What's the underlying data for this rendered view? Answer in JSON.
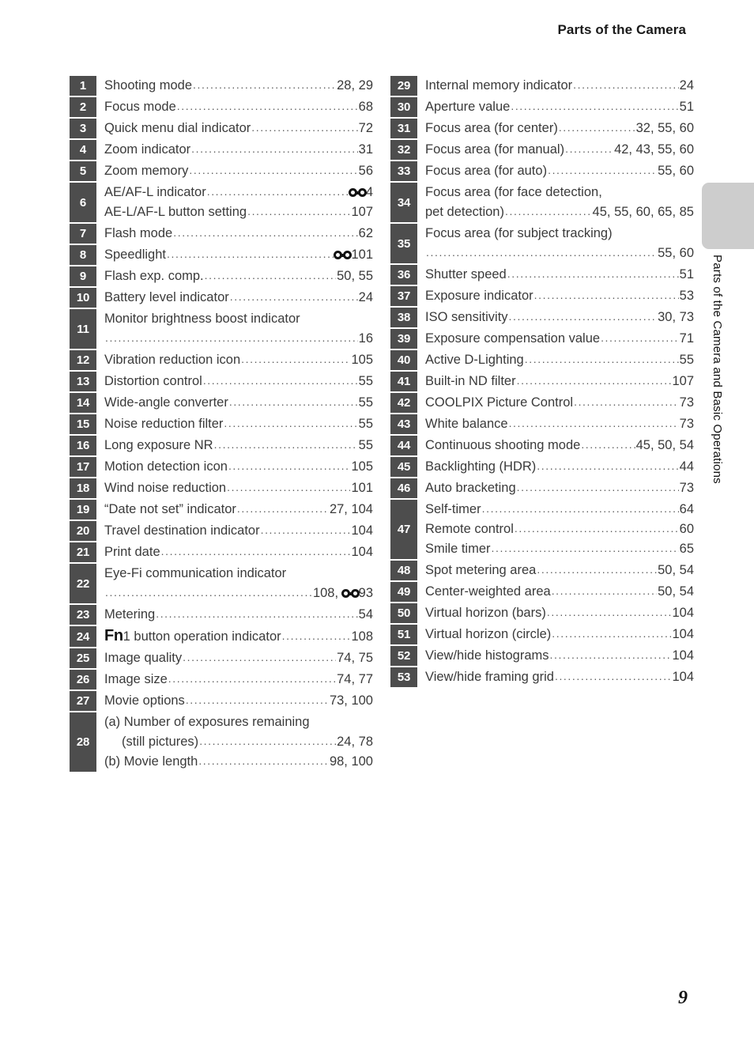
{
  "header": {
    "title": "Parts of the Camera"
  },
  "side_tab": {
    "label": "Parts of the Camera and Basic Operations"
  },
  "folio": {
    "page_number": "9"
  },
  "icons": {
    "reference_mark": "reference-section-icon",
    "fn_mark": "Fn"
  },
  "colors": {
    "badge_bg": "#4d4d4d",
    "badge_text": "#ffffff",
    "body_text": "#3a3a3a",
    "tab_gray": "#cdcdcd"
  },
  "left_column": [
    {
      "num": "1",
      "lines": [
        {
          "label": "Shooting mode",
          "pages": "28, 29"
        }
      ]
    },
    {
      "num": "2",
      "lines": [
        {
          "label": "Focus mode",
          "pages": "68"
        }
      ]
    },
    {
      "num": "3",
      "lines": [
        {
          "label": "Quick menu dial indicator",
          "pages": "72"
        }
      ]
    },
    {
      "num": "4",
      "lines": [
        {
          "label": "Zoom indicator",
          "pages": "31"
        }
      ]
    },
    {
      "num": "5",
      "lines": [
        {
          "label": "Zoom memory",
          "pages": "56"
        }
      ]
    },
    {
      "num": "6",
      "lines": [
        {
          "label": "AE/AF-L indicator",
          "pages": "4",
          "ref": true
        },
        {
          "label": "AE-L/AF-L button setting",
          "pages": "107"
        }
      ]
    },
    {
      "num": "7",
      "lines": [
        {
          "label": "Flash mode",
          "pages": "62"
        }
      ]
    },
    {
      "num": "8",
      "lines": [
        {
          "label": "Speedlight",
          "pages": "101",
          "ref": true
        }
      ]
    },
    {
      "num": "9",
      "lines": [
        {
          "label": "Flash exp. comp.",
          "pages": "50, 55"
        }
      ]
    },
    {
      "num": "10",
      "lines": [
        {
          "label": "Battery level indicator",
          "pages": "24"
        }
      ]
    },
    {
      "num": "11",
      "lines": [
        {
          "label": "Monitor brightness boost indicator",
          "pages": ""
        },
        {
          "label": "",
          "pages": "16",
          "continuation": true
        }
      ]
    },
    {
      "num": "12",
      "lines": [
        {
          "label": "Vibration reduction icon",
          "pages": "105"
        }
      ]
    },
    {
      "num": "13",
      "lines": [
        {
          "label": "Distortion control",
          "pages": "55"
        }
      ]
    },
    {
      "num": "14",
      "lines": [
        {
          "label": "Wide-angle converter",
          "pages": "55"
        }
      ]
    },
    {
      "num": "15",
      "lines": [
        {
          "label": "Noise reduction filter",
          "pages": "55"
        }
      ]
    },
    {
      "num": "16",
      "lines": [
        {
          "label": "Long exposure NR",
          "pages": "55"
        }
      ]
    },
    {
      "num": "17",
      "lines": [
        {
          "label": "Motion detection icon",
          "pages": "105"
        }
      ]
    },
    {
      "num": "18",
      "lines": [
        {
          "label": "Wind noise reduction",
          "pages": "101"
        }
      ]
    },
    {
      "num": "19",
      "lines": [
        {
          "label": "“Date not set” indicator",
          "pages": "27, 104"
        }
      ]
    },
    {
      "num": "20",
      "lines": [
        {
          "label": "Travel destination indicator",
          "pages": "104"
        }
      ]
    },
    {
      "num": "21",
      "lines": [
        {
          "label": "Print date",
          "pages": "104"
        }
      ]
    },
    {
      "num": "22",
      "lines": [
        {
          "label": "Eye-Fi communication indicator",
          "pages": ""
        },
        {
          "label": "",
          "pages": "108, 93",
          "ref_inline": true,
          "continuation": true
        }
      ]
    },
    {
      "num": "23",
      "lines": [
        {
          "label": "Metering",
          "pages": "54"
        }
      ]
    },
    {
      "num": "24",
      "lines": [
        {
          "label": "1 button operation indicator",
          "pages": "108",
          "fn": true
        }
      ]
    },
    {
      "num": "25",
      "lines": [
        {
          "label": "Image quality",
          "pages": "74, 75"
        }
      ]
    },
    {
      "num": "26",
      "lines": [
        {
          "label": "Image size",
          "pages": "74, 77"
        }
      ]
    },
    {
      "num": "27",
      "lines": [
        {
          "label": "Movie options",
          "pages": "73, 100"
        }
      ]
    },
    {
      "num": "28",
      "lines": [
        {
          "label": "(a) Number of exposures remaining",
          "pages": ""
        },
        {
          "label": "(still pictures)",
          "pages": "24, 78",
          "indent": true
        },
        {
          "label": "(b) Movie length",
          "pages": "98, 100"
        }
      ]
    }
  ],
  "right_column": [
    {
      "num": "29",
      "lines": [
        {
          "label": "Internal memory indicator",
          "pages": "24"
        }
      ]
    },
    {
      "num": "30",
      "lines": [
        {
          "label": "Aperture value",
          "pages": "51"
        }
      ]
    },
    {
      "num": "31",
      "lines": [
        {
          "label": "Focus area (for center)",
          "pages": "32, 55, 60"
        }
      ]
    },
    {
      "num": "32",
      "lines": [
        {
          "label": "Focus area (for manual)",
          "pages": "42, 43, 55, 60"
        }
      ]
    },
    {
      "num": "33",
      "lines": [
        {
          "label": "Focus area (for auto)",
          "pages": "55, 60"
        }
      ]
    },
    {
      "num": "34",
      "lines": [
        {
          "label": "Focus area (for face detection,",
          "pages": ""
        },
        {
          "label": "pet detection)",
          "pages": "45, 55, 60, 65, 85"
        }
      ]
    },
    {
      "num": "35",
      "lines": [
        {
          "label": "Focus area (for subject tracking)",
          "pages": ""
        },
        {
          "label": "",
          "pages": "55, 60",
          "continuation": true
        }
      ]
    },
    {
      "num": "36",
      "lines": [
        {
          "label": "Shutter speed",
          "pages": "51"
        }
      ]
    },
    {
      "num": "37",
      "lines": [
        {
          "label": "Exposure indicator",
          "pages": "53"
        }
      ]
    },
    {
      "num": "38",
      "lines": [
        {
          "label": "ISO sensitivity",
          "pages": "30, 73"
        }
      ]
    },
    {
      "num": "39",
      "lines": [
        {
          "label": "Exposure compensation value",
          "pages": "71"
        }
      ]
    },
    {
      "num": "40",
      "lines": [
        {
          "label": "Active D-Lighting",
          "pages": "55"
        }
      ]
    },
    {
      "num": "41",
      "lines": [
        {
          "label": "Built-in ND filter",
          "pages": "107"
        }
      ]
    },
    {
      "num": "42",
      "lines": [
        {
          "label": "COOLPIX Picture Control",
          "pages": "73"
        }
      ]
    },
    {
      "num": "43",
      "lines": [
        {
          "label": "White balance",
          "pages": "73"
        }
      ]
    },
    {
      "num": "44",
      "lines": [
        {
          "label": "Continuous shooting mode",
          "pages": "45, 50, 54"
        }
      ]
    },
    {
      "num": "45",
      "lines": [
        {
          "label": "Backlighting (HDR)",
          "pages": "44"
        }
      ]
    },
    {
      "num": "46",
      "lines": [
        {
          "label": "Auto bracketing",
          "pages": "73"
        }
      ]
    },
    {
      "num": "47",
      "lines": [
        {
          "label": "Self-timer",
          "pages": "64"
        },
        {
          "label": "Remote control",
          "pages": "60"
        },
        {
          "label": "Smile timer",
          "pages": "65"
        }
      ]
    },
    {
      "num": "48",
      "lines": [
        {
          "label": "Spot metering area",
          "pages": "50, 54"
        }
      ]
    },
    {
      "num": "49",
      "lines": [
        {
          "label": "Center-weighted area",
          "pages": "50, 54"
        }
      ]
    },
    {
      "num": "50",
      "lines": [
        {
          "label": "Virtual horizon (bars)",
          "pages": "104"
        }
      ]
    },
    {
      "num": "51",
      "lines": [
        {
          "label": "Virtual horizon (circle)",
          "pages": "104"
        }
      ]
    },
    {
      "num": "52",
      "lines": [
        {
          "label": "View/hide histograms",
          "pages": "104"
        }
      ]
    },
    {
      "num": "53",
      "lines": [
        {
          "label": "View/hide framing grid",
          "pages": "104"
        }
      ]
    }
  ]
}
